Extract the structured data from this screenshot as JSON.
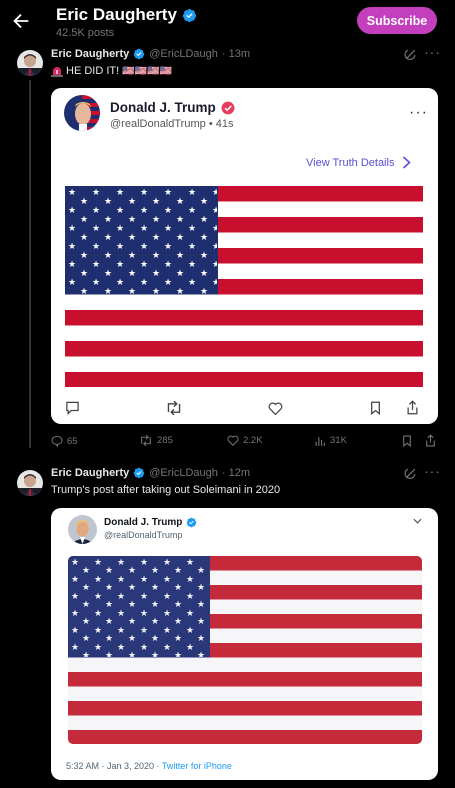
{
  "header": {
    "title": "Eric Daugherty",
    "post_count": "42.5K posts",
    "subscribe_label": "Subscribe"
  },
  "tweet1": {
    "name": "Eric Daugherty",
    "handle": "@EricLDaugh",
    "time": "· 13m",
    "text": "HE DID IT!",
    "flags": "🇺🇸🇺🇸🇺🇸🇺🇸",
    "stats": {
      "replies": "65",
      "retweets": "285",
      "likes": "2.2K",
      "views": "31K"
    }
  },
  "truth_card": {
    "name": "Donald J. Trump",
    "handle": "@realDonaldTrump",
    "time": "• 41s",
    "link_label": "View Truth Details"
  },
  "tweet2": {
    "name": "Eric Daugherty",
    "handle": "@EricLDaugh",
    "time": "· 12m",
    "text": "Trump's post after taking out Soleimani in 2020"
  },
  "embedded_tweet": {
    "name": "Donald J. Trump",
    "handle": "@realDonaldTrump",
    "timestamp": "5:32 AM · Jan 3, 2020 ·",
    "source": "Twitter for iPhone"
  },
  "colors": {
    "background": "#000000",
    "subscribe": "#c43fbd",
    "verified": "#1d9bf0",
    "truth_link": "#5b4fd4",
    "flag_red": "#c8102e",
    "flag_blue": "#1f2e6e"
  },
  "icons": [
    "back-arrow-icon",
    "verified-badge-icon",
    "grok-icon",
    "more-icon",
    "siren-icon",
    "reply-icon",
    "retweet-icon",
    "like-icon",
    "views-icon",
    "bookmark-icon",
    "share-icon",
    "chevron-right-icon",
    "chevron-down-icon"
  ]
}
